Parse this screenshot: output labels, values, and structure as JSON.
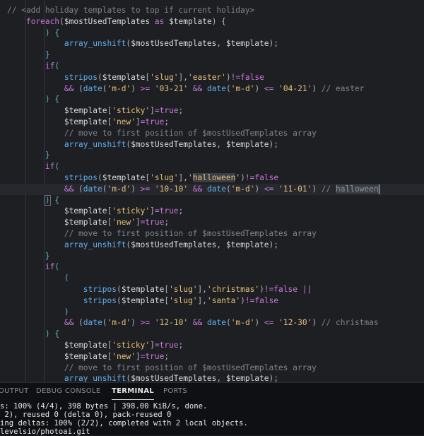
{
  "editor": {
    "lines": [
      [
        [
          "t-comment",
          "// <add holiday templates to top if current holiday>"
        ]
      ],
      [
        [
          "t-punc",
          "    "
        ],
        [
          "t-kw",
          "foreach"
        ],
        [
          "t-punc",
          "("
        ],
        [
          "t-var",
          "$mostUsedTemplates"
        ],
        [
          "t-kw",
          " as "
        ],
        [
          "t-var",
          "$template"
        ],
        [
          "t-punc",
          ") {"
        ]
      ],
      [
        [
          "t-punc",
          "        "
        ],
        [
          "t-brace",
          ") {"
        ]
      ],
      [
        [
          "t-punc",
          "            "
        ],
        [
          "t-fn",
          "array_unshift"
        ],
        [
          "t-punc",
          "("
        ],
        [
          "t-var",
          "$mostUsedTemplates"
        ],
        [
          "t-punc",
          ", "
        ],
        [
          "t-var",
          "$template"
        ],
        [
          "t-punc",
          ");"
        ]
      ],
      [
        [
          "t-punc",
          "        "
        ],
        [
          "t-brace",
          "}"
        ]
      ],
      [
        [
          "t-punc",
          "        "
        ],
        [
          "t-kw",
          "if"
        ],
        [
          "t-brace",
          "("
        ]
      ],
      [
        [
          "t-punc",
          "            "
        ],
        [
          "t-fn",
          "stripos"
        ],
        [
          "t-punc",
          "("
        ],
        [
          "t-var",
          "$template"
        ],
        [
          "t-punc",
          "["
        ],
        [
          "t-str",
          "'slug'"
        ],
        [
          "t-punc",
          "],"
        ],
        [
          "t-str",
          "'easter'"
        ],
        [
          "t-punc",
          ")"
        ],
        [
          "t-op",
          "!="
        ],
        [
          "t-bool",
          "false"
        ]
      ],
      [
        [
          "t-punc",
          "            "
        ],
        [
          "t-op",
          "&&"
        ],
        [
          "t-punc",
          " ("
        ],
        [
          "t-fn",
          "date"
        ],
        [
          "t-punc",
          "("
        ],
        [
          "t-str",
          "'m-d'"
        ],
        [
          "t-punc",
          ") "
        ],
        [
          "t-op",
          ">="
        ],
        [
          "t-punc",
          " "
        ],
        [
          "t-str",
          "'03-21'"
        ],
        [
          "t-punc",
          " "
        ],
        [
          "t-op",
          "&&"
        ],
        [
          "t-punc",
          " "
        ],
        [
          "t-fn",
          "date"
        ],
        [
          "t-punc",
          "("
        ],
        [
          "t-str",
          "'m-d'"
        ],
        [
          "t-punc",
          ") "
        ],
        [
          "t-op",
          "<="
        ],
        [
          "t-punc",
          " "
        ],
        [
          "t-str",
          "'04-21'"
        ],
        [
          "t-punc",
          ") "
        ],
        [
          "t-comment",
          "// easter"
        ]
      ],
      [
        [
          "t-punc",
          "        "
        ],
        [
          "t-brace",
          ") {"
        ]
      ],
      [
        [
          "t-punc",
          "            "
        ],
        [
          "t-var",
          "$template"
        ],
        [
          "t-punc",
          "["
        ],
        [
          "t-str",
          "'sticky'"
        ],
        [
          "t-punc",
          "]"
        ],
        [
          "t-op",
          "="
        ],
        [
          "t-bool",
          "true"
        ],
        [
          "t-punc",
          ";"
        ]
      ],
      [
        [
          "t-punc",
          "            "
        ],
        [
          "t-var",
          "$template"
        ],
        [
          "t-punc",
          "["
        ],
        [
          "t-str",
          "'new'"
        ],
        [
          "t-punc",
          "]"
        ],
        [
          "t-op",
          "="
        ],
        [
          "t-bool",
          "true"
        ],
        [
          "t-punc",
          ";"
        ]
      ],
      [
        [
          "t-punc",
          "            "
        ],
        [
          "t-comment",
          "// move to first position of $mostUsedTemplates array"
        ]
      ],
      [
        [
          "t-punc",
          "            "
        ],
        [
          "t-fn",
          "array_unshift"
        ],
        [
          "t-punc",
          "("
        ],
        [
          "t-var",
          "$mostUsedTemplates"
        ],
        [
          "t-punc",
          ", "
        ],
        [
          "t-var",
          "$template"
        ],
        [
          "t-punc",
          ");"
        ]
      ],
      [
        [
          "t-punc",
          "        "
        ],
        [
          "t-brace",
          "}"
        ]
      ],
      [
        [
          "t-punc",
          "        "
        ],
        [
          "t-kw",
          "if"
        ],
        [
          "t-brace",
          "("
        ]
      ],
      [
        [
          "t-punc",
          "            "
        ],
        [
          "t-fn",
          "stripos"
        ],
        [
          "t-punc",
          "("
        ],
        [
          "t-var",
          "$template"
        ],
        [
          "t-punc",
          "["
        ],
        [
          "t-str",
          "'slug'"
        ],
        [
          "t-punc",
          "],"
        ],
        [
          "t-str",
          "'"
        ],
        [
          "t-str word-hl",
          "halloween"
        ],
        [
          "t-str",
          "'"
        ],
        [
          "t-punc",
          ")"
        ],
        [
          "t-op",
          "!="
        ],
        [
          "t-bool",
          "false"
        ]
      ],
      [
        [
          "t-punc",
          "            "
        ],
        [
          "t-op",
          "&&"
        ],
        [
          "t-punc",
          " ("
        ],
        [
          "t-fn",
          "date"
        ],
        [
          "t-punc",
          "("
        ],
        [
          "t-str",
          "'m-d'"
        ],
        [
          "t-punc",
          ") "
        ],
        [
          "t-op",
          ">="
        ],
        [
          "t-punc",
          " "
        ],
        [
          "t-str",
          "'10-10'"
        ],
        [
          "t-punc",
          " "
        ],
        [
          "t-op",
          "&&"
        ],
        [
          "t-punc",
          " "
        ],
        [
          "t-fn",
          "date"
        ],
        [
          "t-punc",
          "("
        ],
        [
          "t-str",
          "'m-d'"
        ],
        [
          "t-punc",
          ") "
        ],
        [
          "t-op",
          "<="
        ],
        [
          "t-punc",
          " "
        ],
        [
          "t-str",
          "'11-01'"
        ],
        [
          "t-punc",
          ") "
        ],
        [
          "t-comment",
          "// "
        ],
        [
          "t-cmt-hl word-hl",
          "halloween"
        ]
      ],
      [
        [
          "t-punc",
          "        "
        ],
        [
          "t-brace bracket-hl",
          ")"
        ],
        [
          "t-brace",
          " {"
        ]
      ],
      [
        [
          "t-punc",
          "            "
        ],
        [
          "t-var",
          "$template"
        ],
        [
          "t-punc",
          "["
        ],
        [
          "t-str",
          "'sticky'"
        ],
        [
          "t-punc",
          "]"
        ],
        [
          "t-op",
          "="
        ],
        [
          "t-bool",
          "true"
        ],
        [
          "t-punc",
          ";"
        ]
      ],
      [
        [
          "t-punc",
          "            "
        ],
        [
          "t-var",
          "$template"
        ],
        [
          "t-punc",
          "["
        ],
        [
          "t-str",
          "'new'"
        ],
        [
          "t-punc",
          "]"
        ],
        [
          "t-op",
          "="
        ],
        [
          "t-bool",
          "true"
        ],
        [
          "t-punc",
          ";"
        ]
      ],
      [
        [
          "t-punc",
          "            "
        ],
        [
          "t-comment",
          "// move to first position of $mostUsedTemplates array"
        ]
      ],
      [
        [
          "t-punc",
          "            "
        ],
        [
          "t-fn",
          "array_unshift"
        ],
        [
          "t-punc",
          "("
        ],
        [
          "t-var",
          "$mostUsedTemplates"
        ],
        [
          "t-punc",
          ", "
        ],
        [
          "t-var",
          "$template"
        ],
        [
          "t-punc",
          ");"
        ]
      ],
      [
        [
          "t-punc",
          "        "
        ],
        [
          "t-brace",
          "}"
        ]
      ],
      [
        [
          "t-punc",
          "        "
        ],
        [
          "t-kw",
          "if"
        ],
        [
          "t-brace",
          "("
        ]
      ],
      [
        [
          "t-punc",
          "            "
        ],
        [
          "t-fn",
          "("
        ]
      ],
      [
        [
          "t-punc",
          "                "
        ],
        [
          "t-fn",
          "stripos"
        ],
        [
          "t-punc",
          "("
        ],
        [
          "t-var",
          "$template"
        ],
        [
          "t-punc",
          "["
        ],
        [
          "t-str",
          "'slug'"
        ],
        [
          "t-punc",
          "],"
        ],
        [
          "t-str",
          "'christmas'"
        ],
        [
          "t-punc",
          ")"
        ],
        [
          "t-op",
          "!="
        ],
        [
          "t-bool",
          "false"
        ],
        [
          "t-punc",
          " "
        ],
        [
          "t-op",
          "||"
        ]
      ],
      [
        [
          "t-punc",
          "                "
        ],
        [
          "t-fn",
          "stripos"
        ],
        [
          "t-punc",
          "("
        ],
        [
          "t-var",
          "$template"
        ],
        [
          "t-punc",
          "["
        ],
        [
          "t-str",
          "'slug'"
        ],
        [
          "t-punc",
          "],"
        ],
        [
          "t-str",
          "'santa'"
        ],
        [
          "t-punc",
          ")"
        ],
        [
          "t-op",
          "!="
        ],
        [
          "t-bool",
          "false"
        ]
      ],
      [
        [
          "t-punc",
          "            "
        ],
        [
          "t-fn",
          ")"
        ]
      ],
      [
        [
          "t-punc",
          "            "
        ],
        [
          "t-op",
          "&&"
        ],
        [
          "t-punc",
          " ("
        ],
        [
          "t-fn",
          "date"
        ],
        [
          "t-punc",
          "("
        ],
        [
          "t-str",
          "'m-d'"
        ],
        [
          "t-punc",
          ") "
        ],
        [
          "t-op",
          ">="
        ],
        [
          "t-punc",
          " "
        ],
        [
          "t-str",
          "'12-10'"
        ],
        [
          "t-punc",
          " "
        ],
        [
          "t-op",
          "&&"
        ],
        [
          "t-punc",
          " "
        ],
        [
          "t-fn",
          "date"
        ],
        [
          "t-punc",
          "("
        ],
        [
          "t-str",
          "'m-d'"
        ],
        [
          "t-punc",
          ") "
        ],
        [
          "t-op",
          "<="
        ],
        [
          "t-punc",
          " "
        ],
        [
          "t-str",
          "'12-30'"
        ],
        [
          "t-punc",
          ") "
        ],
        [
          "t-comment",
          "// christmas"
        ]
      ],
      [
        [
          "t-punc",
          "        "
        ],
        [
          "t-brace",
          ") {"
        ]
      ],
      [
        [
          "t-punc",
          "            "
        ],
        [
          "t-var",
          "$template"
        ],
        [
          "t-punc",
          "["
        ],
        [
          "t-str",
          "'sticky'"
        ],
        [
          "t-punc",
          "]"
        ],
        [
          "t-op",
          "="
        ],
        [
          "t-bool",
          "true"
        ],
        [
          "t-punc",
          ";"
        ]
      ],
      [
        [
          "t-punc",
          "            "
        ],
        [
          "t-var",
          "$template"
        ],
        [
          "t-punc",
          "["
        ],
        [
          "t-str",
          "'new'"
        ],
        [
          "t-punc",
          "]"
        ],
        [
          "t-op",
          "="
        ],
        [
          "t-bool",
          "true"
        ],
        [
          "t-punc",
          ";"
        ]
      ],
      [
        [
          "t-punc",
          "            "
        ],
        [
          "t-comment",
          "// move to first position of $mostUsedTemplates array"
        ]
      ],
      [
        [
          "t-punc",
          "            "
        ],
        [
          "t-fn",
          "array_unshift"
        ],
        [
          "t-punc",
          "("
        ],
        [
          "t-var",
          "$mostUsedTemplates"
        ],
        [
          "t-punc",
          ", "
        ],
        [
          "t-var",
          "$template"
        ],
        [
          "t-punc",
          ");"
        ]
      ]
    ],
    "current_line_index": 16
  },
  "panel": {
    "tabs": [
      {
        "label": "OUTPUT",
        "active": false
      },
      {
        "label": "DEBUG CONSOLE",
        "active": false
      },
      {
        "label": "TERMINAL",
        "active": true
      },
      {
        "label": "PORTS",
        "active": false
      }
    ],
    "terminal_lines": [
      "s: 100% (4/4), 398 bytes | 398.00 KiB/s, done.",
      " 2), reused 0 (delta 0), pack-reused 0",
      "ing deltas: 100% (2/2), completed with 2 local objects.",
      "levelsio/photoai.git"
    ]
  },
  "colors": {
    "keyword": "#c678dd",
    "function": "#61afef",
    "string": "#e5c07b",
    "comment": "#7f848e",
    "variable": "#d7dae0",
    "bracket": "#56b6c2"
  }
}
